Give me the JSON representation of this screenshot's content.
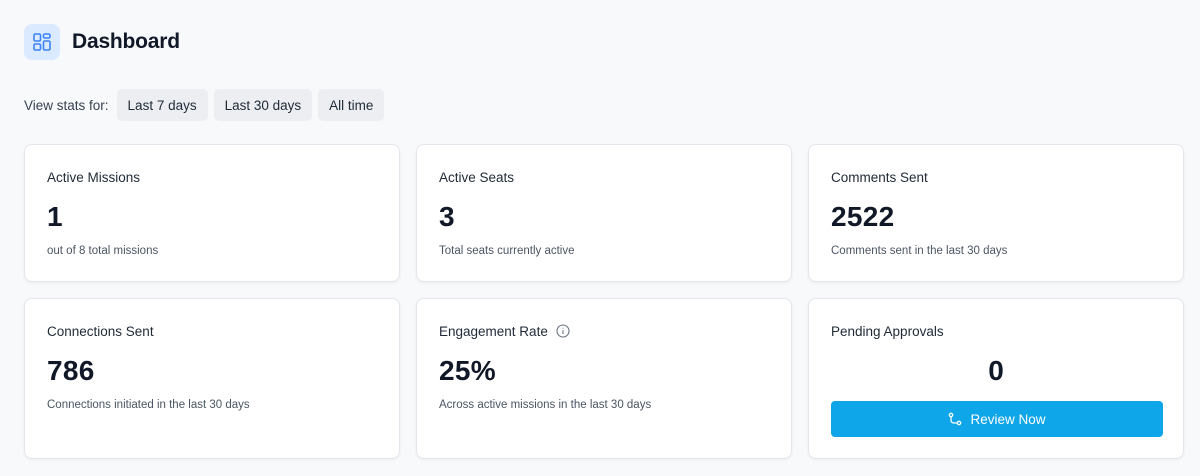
{
  "header": {
    "title": "Dashboard",
    "icon": "dashboard-grid-icon",
    "icon_color": "#3b82f6",
    "icon_bg": "#dbeafe"
  },
  "filters": {
    "label": "View stats for:",
    "options": [
      "Last 7 days",
      "Last 30 days",
      "All time"
    ]
  },
  "cards": {
    "active_missions": {
      "title": "Active Missions",
      "value": "1",
      "subtitle": "out of 8 total missions"
    },
    "active_seats": {
      "title": "Active Seats",
      "value": "3",
      "subtitle": "Total seats currently active"
    },
    "comments_sent": {
      "title": "Comments Sent",
      "value": "2522",
      "subtitle": "Comments sent in the last 30 days"
    },
    "connections_sent": {
      "title": "Connections Sent",
      "value": "786",
      "subtitle": "Connections initiated in the last 30 days"
    },
    "engagement_rate": {
      "title": "Engagement Rate",
      "value": "25%",
      "subtitle": "Across active missions in the last 30 days",
      "icon": "info-icon"
    },
    "pending_approvals": {
      "title": "Pending Approvals",
      "value": "0",
      "button_label": "Review Now",
      "button_icon": "git-branch-icon",
      "button_color": "#0ea5e9"
    }
  }
}
